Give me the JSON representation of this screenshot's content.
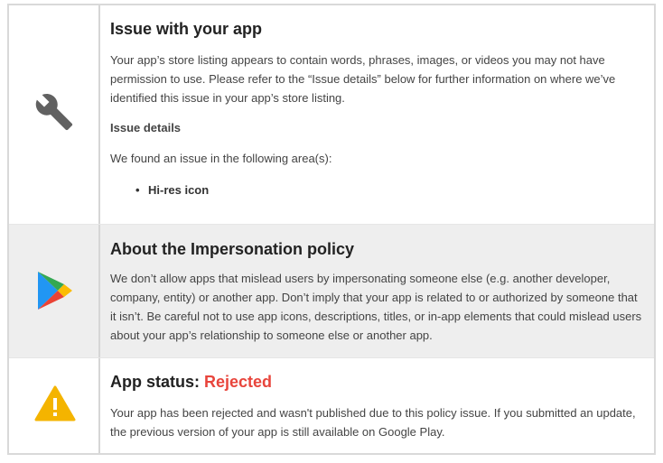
{
  "issue": {
    "title": "Issue with your app",
    "description": "Your app’s store listing appears to contain words, phrases, images, or videos you may not have permission to use. Please refer to the “Issue details” below for further information on where we’ve identified this issue in your app’s store listing.",
    "details_label": "Issue details",
    "area_intro": "We found an issue in the following area(s):",
    "areas": [
      "Hi-res icon"
    ],
    "icon": "wrench-icon"
  },
  "policy": {
    "title": "About the Impersonation policy",
    "description": "We don’t allow apps that mislead users by impersonating someone else (e.g. another developer, company, entity) or another app. Don’t imply that your app is related to or authorized by someone that it isn’t. Be careful not to use app icons, descriptions, titles, or in-app elements that could mislead users about your app’s relationship to someone else or another app.",
    "icon": "google-play-icon"
  },
  "status": {
    "title_prefix": "App status: ",
    "value": "Rejected",
    "description": "Your app has been rejected and wasn't published due to this policy issue. If you submitted an update, the previous version of your app is still available on Google Play.",
    "icon": "warning-icon",
    "value_color": "#e8453c",
    "icon_color": "#f4b400"
  }
}
